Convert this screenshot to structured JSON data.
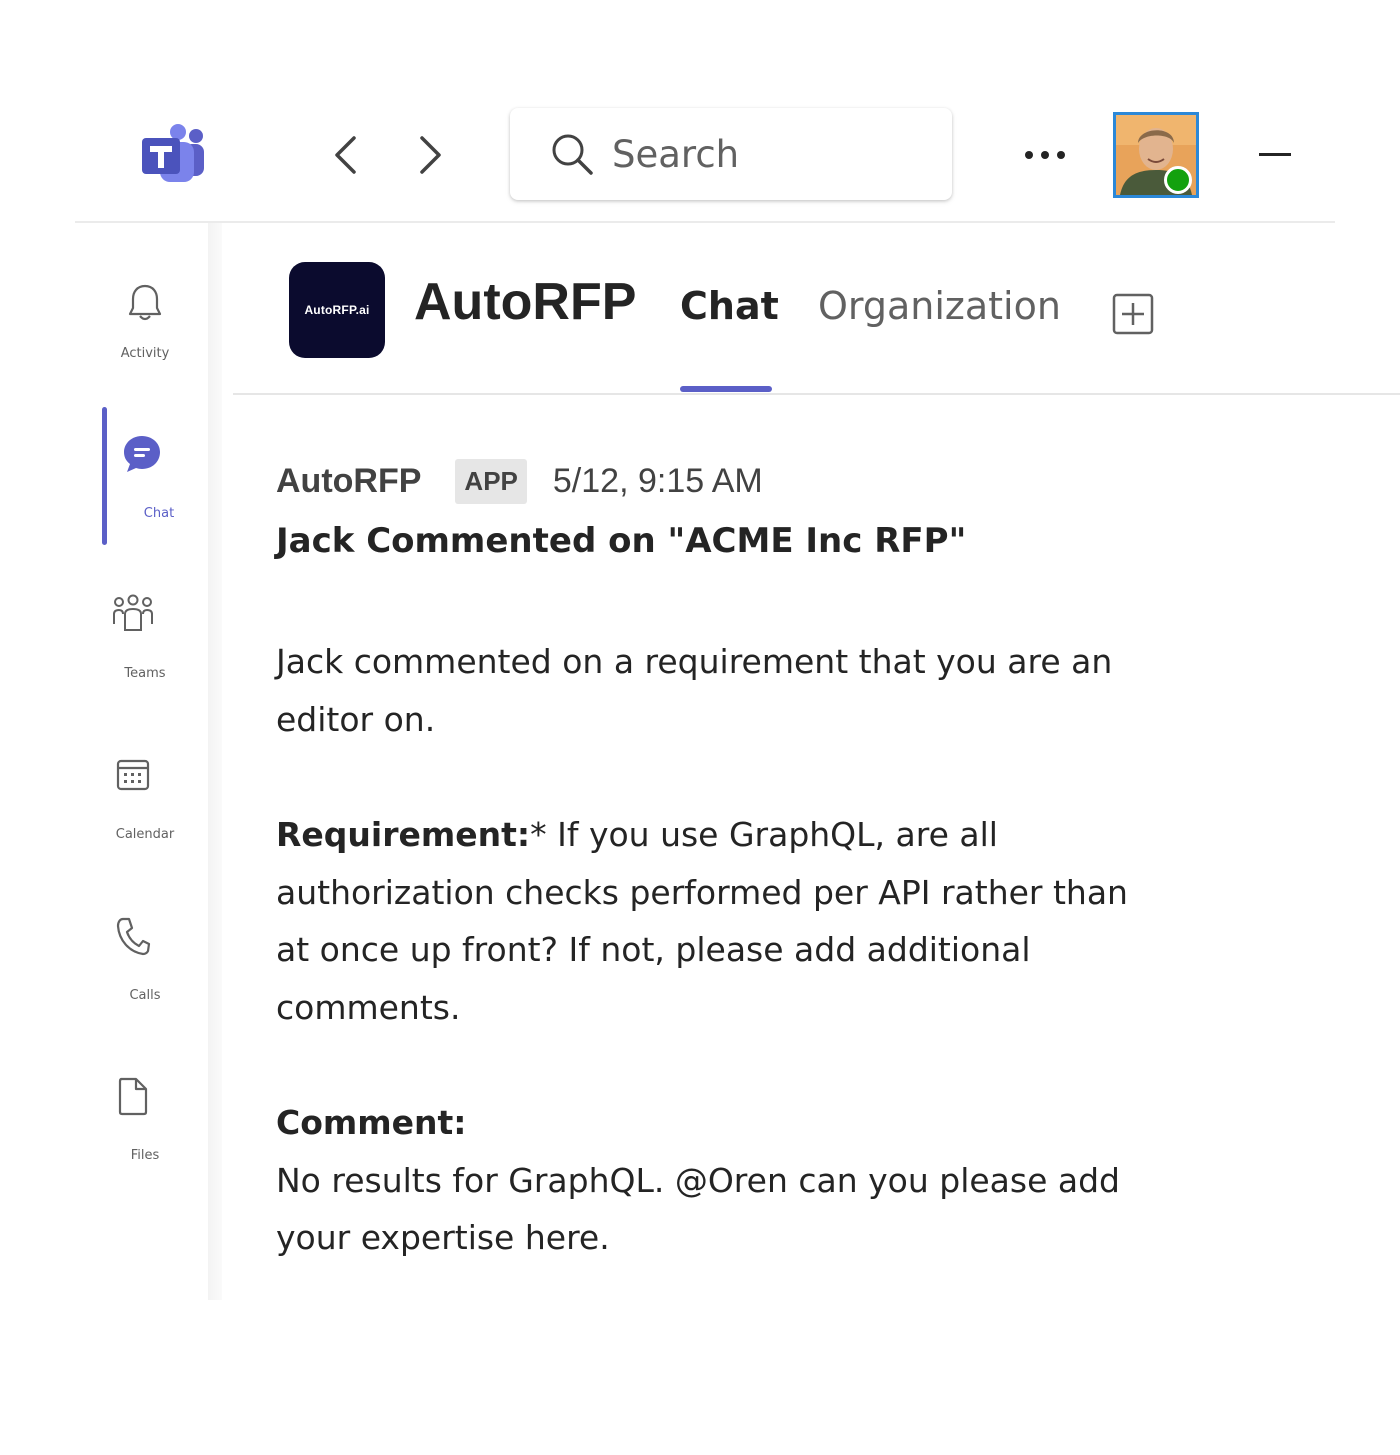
{
  "topbar": {
    "search_placeholder": "Search"
  },
  "rail": {
    "items": [
      {
        "label": "Activity",
        "icon": "bell-icon"
      },
      {
        "label": "Chat",
        "icon": "chat-icon"
      },
      {
        "label": "Teams",
        "icon": "teams-icon"
      },
      {
        "label": "Calendar",
        "icon": "calendar-icon"
      },
      {
        "label": "Calls",
        "icon": "phone-icon"
      },
      {
        "label": "Files",
        "icon": "file-icon"
      }
    ],
    "active": "Chat"
  },
  "header": {
    "app_name": "AutoRFP",
    "logo_text": "AutoRFP.ai",
    "tabs": [
      {
        "label": "Chat",
        "active": true
      },
      {
        "label": "Organization",
        "active": false
      }
    ]
  },
  "message": {
    "sender": "AutoRFP",
    "badge": "APP",
    "timestamp": "5/12, 9:15 AM",
    "title": "Jack Commented on \"ACME Inc RFP\"",
    "intro": "Jack commented on a requirement that you are an editor on.",
    "requirement_label": "Requirement:",
    "requirement_text": "* If you use GraphQL, are all authorization checks performed per API rather than at once up front? If not, please add additional comments.",
    "comment_label": "Comment:",
    "comment_text": "No results for GraphQL. @Oren can you please add your expertise here."
  },
  "colors": {
    "accent": "#5b5fc7",
    "presence": "#13a10e",
    "avatar_border": "#2b88d8"
  }
}
